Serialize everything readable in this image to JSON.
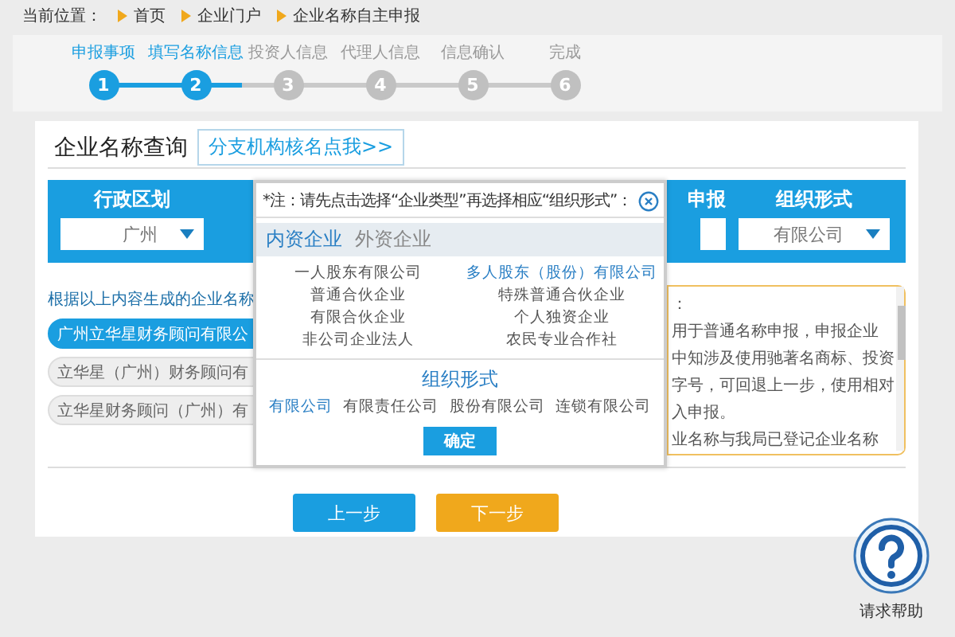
{
  "breadcrumb": {
    "label": "当前位置：",
    "items": [
      "首页",
      "企业门户",
      "企业名称自主申报"
    ]
  },
  "steps": [
    {
      "label": "申报事项",
      "number": "1",
      "completed": true
    },
    {
      "label": "填写名称信息",
      "number": "2",
      "completed": true
    },
    {
      "label": "投资人信息",
      "number": "3",
      "completed": false
    },
    {
      "label": "代理人信息",
      "number": "4",
      "completed": false
    },
    {
      "label": "信息确认",
      "number": "5",
      "completed": false
    },
    {
      "label": "完成",
      "number": "6",
      "completed": false
    }
  ],
  "query": {
    "title": "企业名称查询",
    "branch_button": "分支机构核名点我>>"
  },
  "filters": [
    {
      "kind": "select",
      "label": "行政区划",
      "value": "广州"
    },
    {
      "kind": "label",
      "label": "申报"
    },
    {
      "kind": "select",
      "label": "组织形式",
      "value": "有限公司"
    }
  ],
  "results": {
    "caption": "根据以上内容生成的企业名称",
    "names": [
      {
        "text": "广州立华星财务顾问有限公",
        "selected": true
      },
      {
        "text": "立华星（广州）财务顾问有",
        "selected": false
      },
      {
        "text": "立华星财务顾问（广州）有",
        "selected": false
      }
    ]
  },
  "notice": [
    "：",
    "用于普通名称申报，申报企业",
    "中知涉及使用驰著名商标、投资",
    "字号，可回退上一步，使用相对",
    "入申报。",
    "业名称与我局已登记企业名称"
  ],
  "buttons": [
    {
      "kind": "back",
      "label": "上一步"
    },
    {
      "kind": "next",
      "label": "下一步"
    }
  ],
  "help": {
    "label": "请求帮助"
  },
  "modal": {
    "note": "*注：请先点击选择“企业类型”再选择相应“组织形式”：",
    "tabs": [
      {
        "label": "内资企业",
        "selected": true
      },
      {
        "label": "外资企业",
        "selected": false
      }
    ],
    "types": [
      {
        "label": "一人股东有限公司",
        "selected": false
      },
      {
        "label": "多人股东（股份）有限公司",
        "selected": true
      },
      {
        "label": "普通合伙企业",
        "selected": false
      },
      {
        "label": "特殊普通合伙企业",
        "selected": false
      },
      {
        "label": "有限合伙企业",
        "selected": false
      },
      {
        "label": "个人独资企业",
        "selected": false
      },
      {
        "label": "非公司企业法人",
        "selected": false
      },
      {
        "label": "农民专业合作社",
        "selected": false
      }
    ],
    "form_title": "组织形式",
    "forms": [
      {
        "label": "有限公司",
        "selected": true
      },
      {
        "label": "有限责任公司",
        "selected": false
      },
      {
        "label": "股份有限公司",
        "selected": false
      },
      {
        "label": "连锁有限公司",
        "selected": false
      }
    ],
    "confirm": "确定"
  }
}
